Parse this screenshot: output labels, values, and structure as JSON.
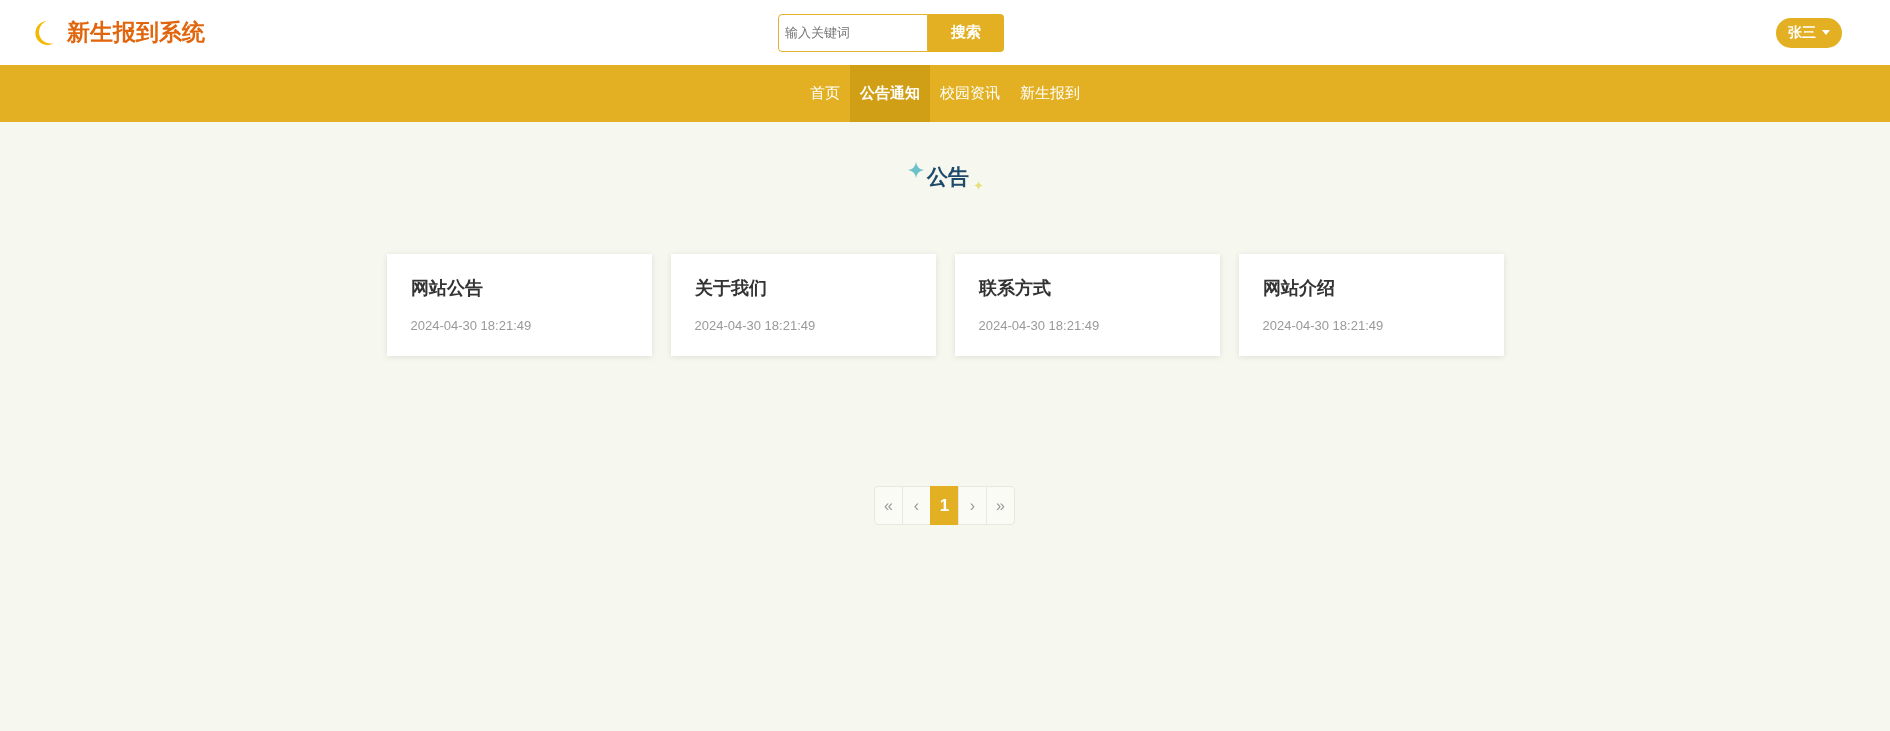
{
  "header": {
    "logo_text": "新生报到系统",
    "search": {
      "placeholder": "输入关键词",
      "button": "搜索"
    },
    "user": {
      "name": "张三"
    }
  },
  "nav": [
    {
      "label": "首页",
      "selected": false
    },
    {
      "label": "公告通知",
      "selected": true
    },
    {
      "label": "校园资讯",
      "selected": false
    },
    {
      "label": "新生报到",
      "selected": false
    }
  ],
  "section_title": "公告",
  "notices": [
    {
      "title": "网站公告",
      "date": "2024-04-30 18:21:49"
    },
    {
      "title": "关于我们",
      "date": "2024-04-30 18:21:49"
    },
    {
      "title": "联系方式",
      "date": "2024-04-30 18:21:49"
    },
    {
      "title": "网站介绍",
      "date": "2024-04-30 18:21:49"
    }
  ],
  "pagination": [
    {
      "label": "«",
      "selected": false
    },
    {
      "label": "‹",
      "selected": false
    },
    {
      "label": "1",
      "selected": true
    },
    {
      "label": "›",
      "selected": false
    },
    {
      "label": "»",
      "selected": false
    }
  ]
}
